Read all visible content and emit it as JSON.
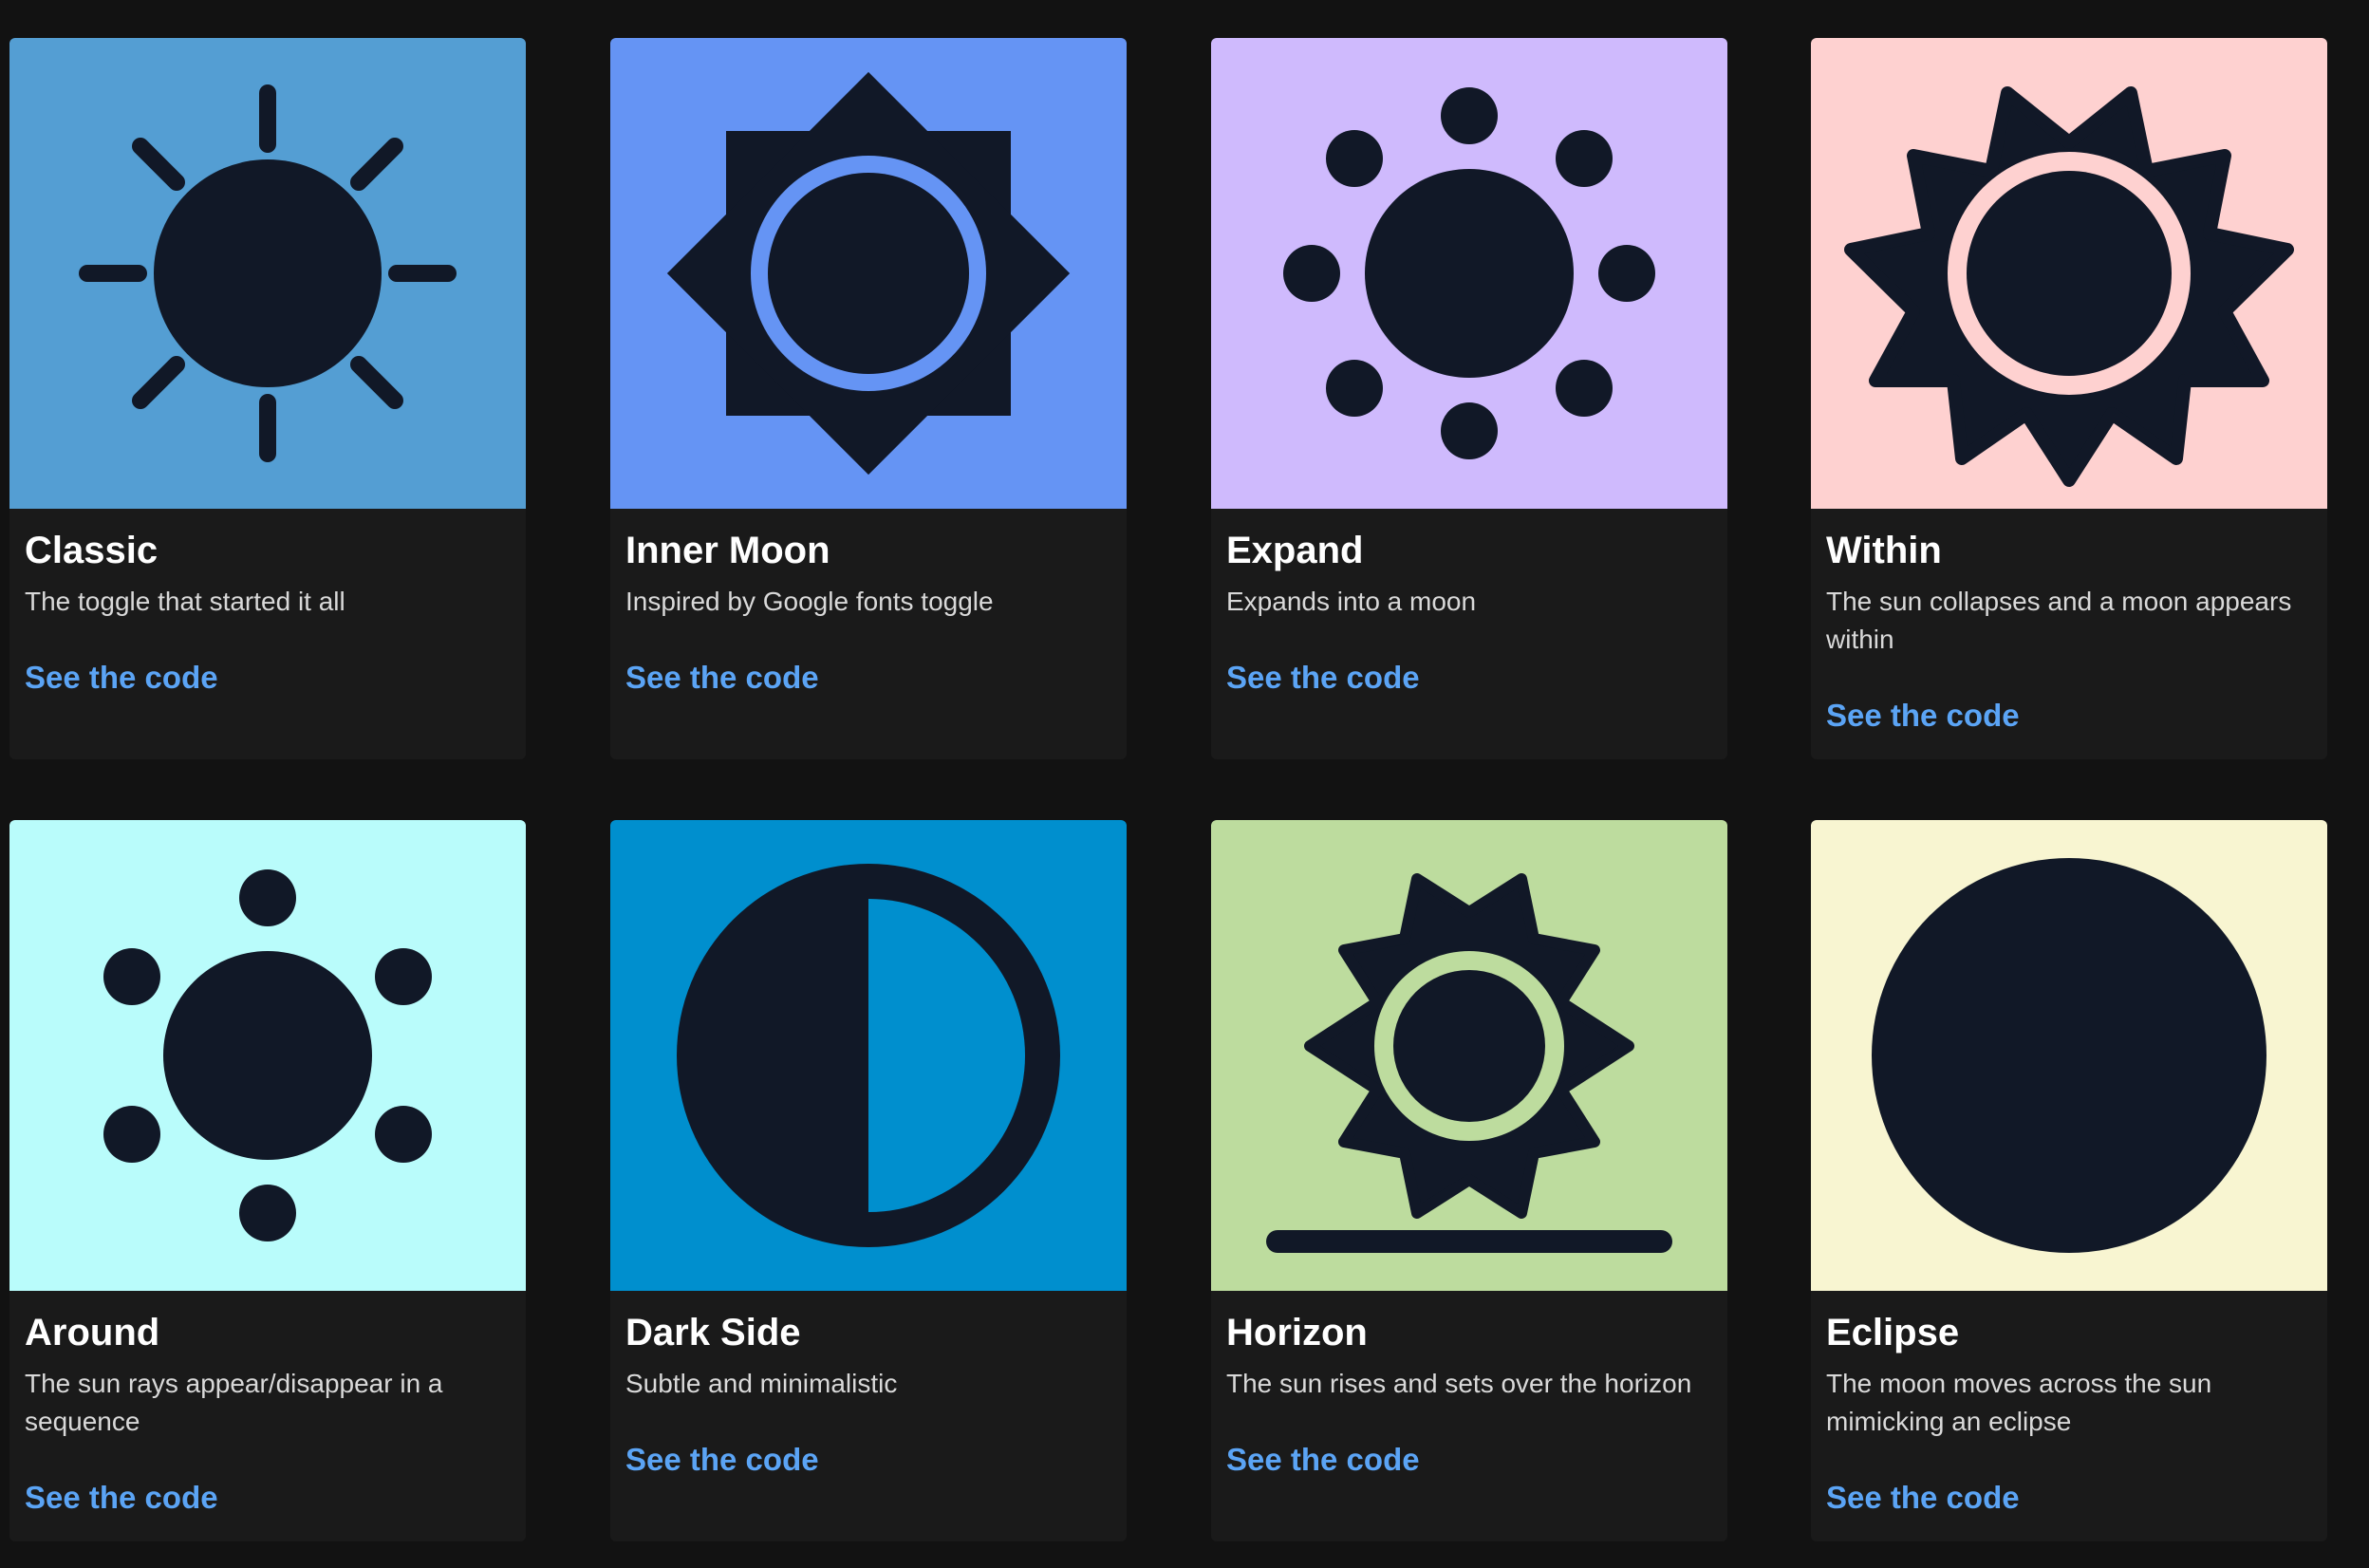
{
  "colors": {
    "icon": "#111827",
    "page_bg": "#121212",
    "card_bg": "#1a1a1a",
    "link": "#5ba4f5"
  },
  "cards": [
    {
      "title": "Classic",
      "description": "The toggle that started it all",
      "link": "See the code",
      "bg": "#549ed3",
      "icon": "classic-sun-icon"
    },
    {
      "title": "Inner Moon",
      "description": "Inspired by Google fonts toggle",
      "link": "See the code",
      "bg": "#6594f4",
      "icon": "inner-moon-icon"
    },
    {
      "title": "Expand",
      "description": "Expands into a moon",
      "link": "See the code",
      "bg": "#cfbafd",
      "icon": "expand-sun-icon"
    },
    {
      "title": "Within",
      "description": "The sun collapses and a moon appears within",
      "link": "See the code",
      "bg": "#fed1d0",
      "icon": "within-sun-icon"
    },
    {
      "title": "Around",
      "description": "The sun rays appear/disappear in a sequence",
      "link": "See the code",
      "bg": "#b9fcfb",
      "icon": "around-sun-icon"
    },
    {
      "title": "Dark Side",
      "description": "Subtle and minimalistic",
      "link": "See the code",
      "bg": "#008fce",
      "icon": "dark-side-icon"
    },
    {
      "title": "Horizon",
      "description": "The sun rises and sets over the horizon",
      "link": "See the code",
      "bg": "#bddc9e",
      "icon": "horizon-sun-icon"
    },
    {
      "title": "Eclipse",
      "description": "The moon moves across the sun mimicking an eclipse",
      "link": "See the code",
      "bg": "#f8f5d1",
      "icon": "eclipse-icon"
    }
  ]
}
